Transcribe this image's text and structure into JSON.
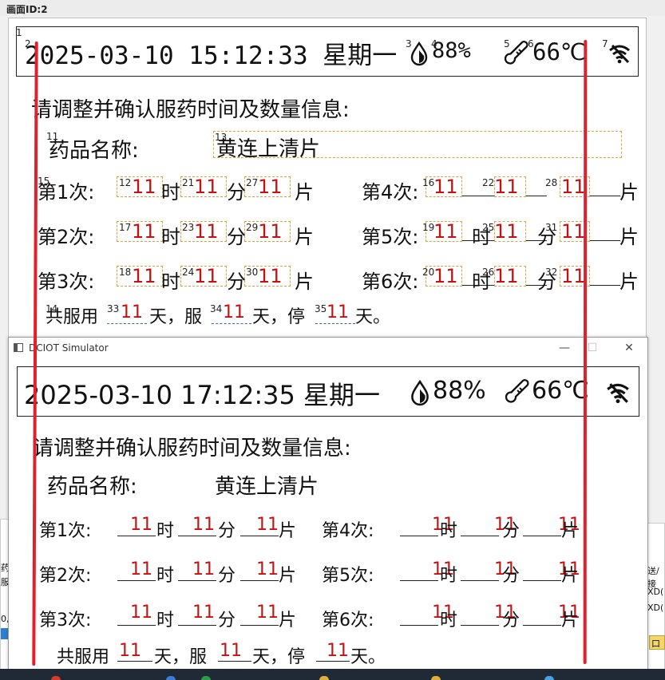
{
  "designer": {
    "id_label": "画面ID:2"
  },
  "status": {
    "top_datetime": "2025-03-10 15:12:33 星期一",
    "sim_datetime": "2025-03-10 17:12:35 星期一",
    "humidity": "88%",
    "temperature": "66℃",
    "icons": [
      "humidity-drop-icon",
      "thermometer-icon",
      "wifi-off-icon"
    ]
  },
  "tags": [
    "1",
    "2",
    "3",
    "4",
    "5",
    "6",
    "7",
    "13",
    "11",
    "15",
    "12",
    "21",
    "27",
    "16",
    "22",
    "28",
    "17",
    "23",
    "29",
    "19",
    "25",
    "31",
    "18",
    "24",
    "30",
    "20",
    "26",
    "32",
    "14",
    "33",
    "34",
    "35"
  ],
  "prompt": "请调整并确认服药时间及数量信息:",
  "drug": {
    "label": "药品名称:",
    "value": "黄连上清片"
  },
  "schedule": {
    "rows": [
      {
        "label": "第1次:",
        "hour": "11",
        "minute": "11",
        "count": "11"
      },
      {
        "label": "第2次:",
        "hour": "11",
        "minute": "11",
        "count": "11"
      },
      {
        "label": "第3次:",
        "hour": "11",
        "minute": "11",
        "count": "11"
      },
      {
        "label": "第4次:",
        "hour": "11",
        "minute": "11",
        "count": "11"
      },
      {
        "label": "第5次:",
        "hour": "11",
        "minute": "11",
        "count": "11"
      },
      {
        "label": "第6次:",
        "hour": "11",
        "minute": "11",
        "count": "11"
      }
    ],
    "unit_hour": "时",
    "unit_minute": "分",
    "unit_count": "片"
  },
  "course": {
    "prefix": "共服用",
    "total": "11",
    "mid1": "天，服",
    "take": "11",
    "mid2": "天，停",
    "stop": "11",
    "suffix": "天。"
  },
  "simulator": {
    "title": "DCIOT Simulator",
    "min": "—",
    "max": "☐",
    "close": "✕"
  },
  "background_app": {
    "left_chars": [
      "药",
      "服",
      "0,"
    ],
    "right_labels": [
      "送/接",
      "XD(",
      "XD(",
      "口"
    ]
  },
  "colors": {
    "value_red": "#c81010",
    "annotation_red": "#e1202b",
    "placeholder_orange": "#d9a441"
  }
}
